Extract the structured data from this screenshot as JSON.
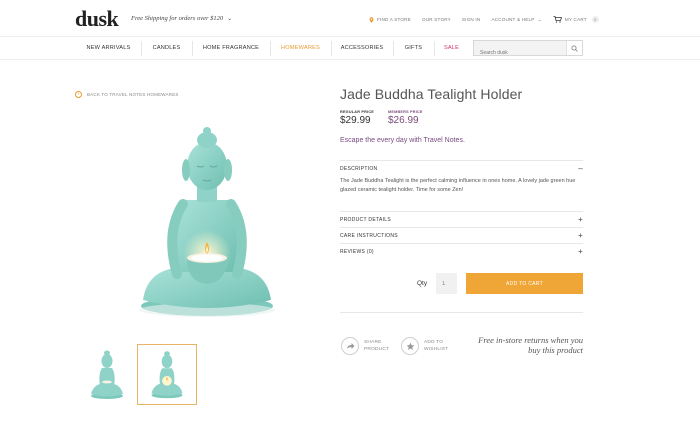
{
  "header": {
    "logo": "dusk",
    "shipping": "Free Shipping for orders over $120",
    "links": [
      "FIND A STORE",
      "OUR STORY",
      "SIGN IN",
      "ACCOUNT & HELP"
    ],
    "cart_label": "MY CART",
    "cart_count": "0"
  },
  "nav": {
    "items": [
      "NEW ARRIVALS",
      "CANDLES",
      "HOME FRAGRANCE",
      "HOMEWARES",
      "ACCESSORIES",
      "GIFTS",
      "SALE"
    ],
    "search_placeholder": "Search dusk"
  },
  "breadcrumb": "BACK TO TRAVEL NOTES HOMEWARES",
  "product": {
    "title": "Jade Buddha Tealight Holder",
    "regular_label": "REGULAR PRICE",
    "regular_price": "$29.99",
    "member_label": "MEMBERS PRICE",
    "member_price": "$26.99",
    "tagline": "Escape the every day with Travel Notes.",
    "description_title": "DESCRIPTION",
    "description": "The Jade Buddha Tealight is the perfect calming influence in ones home. A lovely jade green hue glazed ceramic tealight holder. Time for some Zen!",
    "sections": [
      "PRODUCT DETAILS",
      "CARE INSTRUCTIONS",
      "REVIEWS (0)"
    ],
    "qty_label": "Qty",
    "qty_value": "1",
    "add_to_cart": "ADD TO CART",
    "share_line1": "SHARE",
    "share_line2": "PRODUCT",
    "wish_line1": "ADD TO",
    "wish_line2": "WISHLIST",
    "returns": "Free in-store returns when you buy this product"
  },
  "colors": {
    "accent": "#f0a636",
    "active_nav": "#e89c2f",
    "sale": "#d8306b",
    "member": "#7a4a7a",
    "jade": "#8fd3c8"
  },
  "icons": {
    "store": "location-pin-icon",
    "cart": "cart-icon",
    "search": "search-icon",
    "back": "chevron-left-icon",
    "share": "share-arrow-icon",
    "wishlist": "star-icon"
  }
}
